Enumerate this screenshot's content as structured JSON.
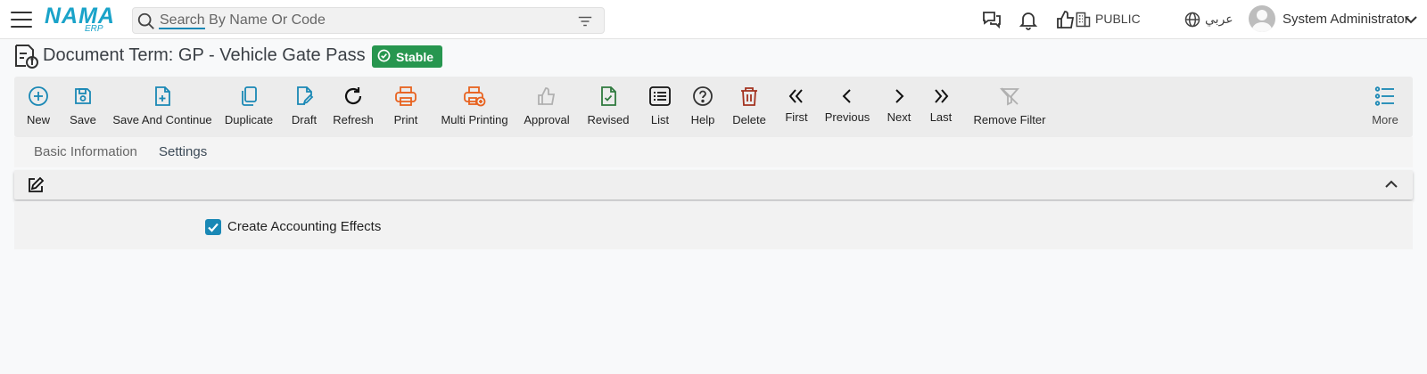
{
  "header": {
    "logo_text": "NAMA",
    "logo_sub": "ERP",
    "search_placeholder": "Search By Name Or Code",
    "branch": "PUBLIC",
    "language": "عربي",
    "user_name": "System Administrator"
  },
  "page": {
    "title": "Document Term: GP - Vehicle Gate Pass",
    "status": "Stable"
  },
  "toolbar": {
    "new": "New",
    "save": "Save",
    "save_continue": "Save And Continue",
    "duplicate": "Duplicate",
    "draft": "Draft",
    "refresh": "Refresh",
    "print": "Print",
    "multi_printing": "Multi Printing",
    "approval": "Approval",
    "revised": "Revised",
    "list": "List",
    "help": "Help",
    "delete": "Delete",
    "first": "First",
    "previous": "Previous",
    "next": "Next",
    "last": "Last",
    "remove_filter": "Remove Filter",
    "more": "More"
  },
  "tabs": {
    "basic_information": "Basic Information",
    "settings": "Settings"
  },
  "settings": {
    "create_accounting_effects": "Create Accounting Effects",
    "create_accounting_effects_checked": true
  },
  "colors": {
    "accent": "#1a88b5",
    "logo": "#1aa3c9",
    "status_green": "#27964f",
    "print_orange": "#e8621f",
    "delete_red": "#a3321f",
    "revised_green": "#2f7a3e",
    "disabled_gray": "#b0b0b0"
  }
}
